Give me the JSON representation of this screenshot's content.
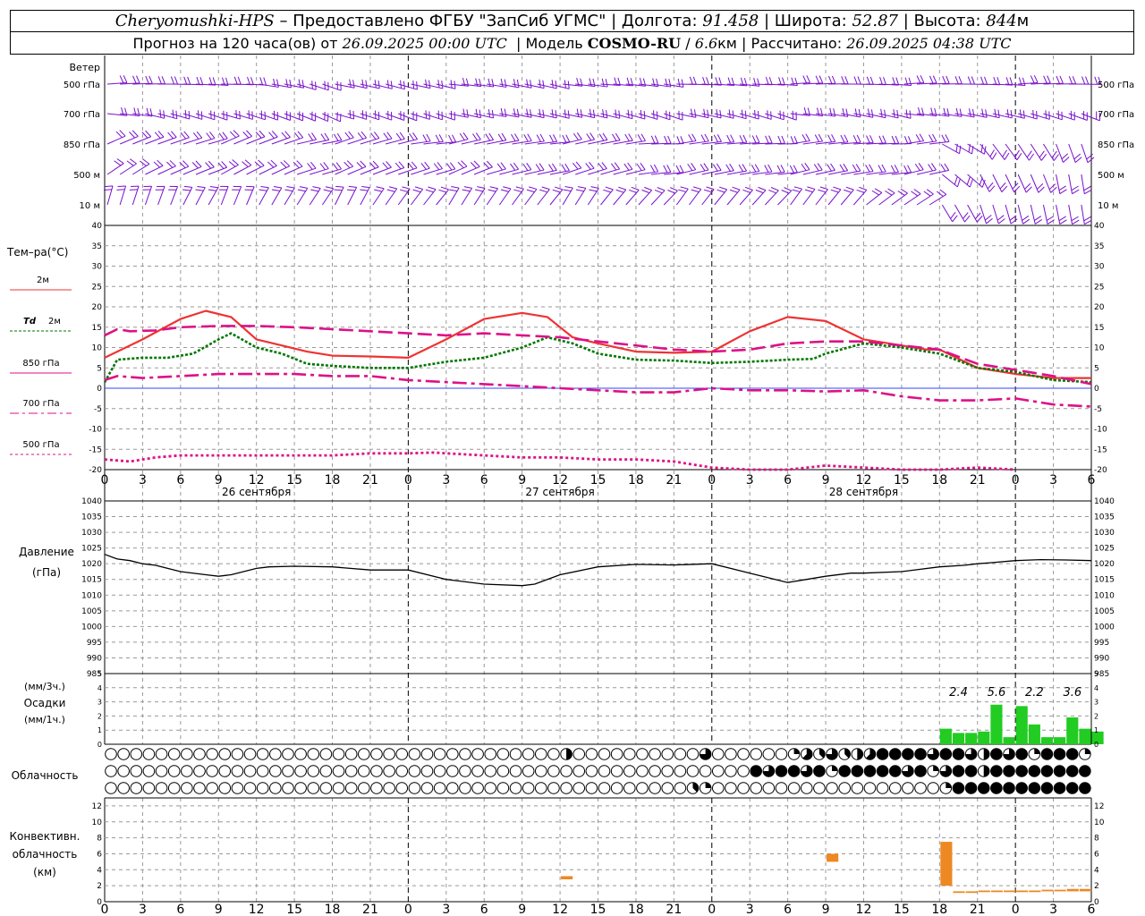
{
  "header": {
    "station": "Cheryomushki-HPS",
    "provided_by": "– Предоставлено ФГБУ \"ЗапСиб УГМС\"",
    "lon_label": "Долгота:",
    "lon_value": "91.458",
    "lat_label": "Широта:",
    "lat_value": "52.87",
    "alt_label": "Высота:",
    "alt_value": "844",
    "alt_unit": "м",
    "forecast_label": "Прогноз на 120 часа(ов) от",
    "forecast_start": "26.09.2025 00:00 UTC",
    "model_label": "Модель",
    "model_name": "COSMO-RU",
    "model_res": "6.6",
    "model_res_unit": "км",
    "computed_label": "Рассчитано:",
    "computed_time": "26.09.2025 04:38 UTC"
  },
  "labels": {
    "wind": "Ветер",
    "wind_levels": [
      "500 гПа",
      "700 гПа",
      "850 гПа",
      "500 м",
      "10 м"
    ],
    "temp_title": "Тем–ра(°С)",
    "t2m": "2м",
    "td": "Td",
    "td2m": "2м",
    "t850": "850 гПа",
    "t700": "700 гПа",
    "t500": "500 гПа",
    "pressure_title": "Давление",
    "pressure_unit": "(гПа)",
    "precip_unit_top": "(мм/3ч.)",
    "precip_title": "Осадки",
    "precip_unit_bottom": "(мм/1ч.)",
    "cloud_title": "Облачность",
    "conv_title1": "Конвективн.",
    "conv_title2": "облачность",
    "conv_unit": "(км)",
    "dates": [
      "26 сентября",
      "27 сентября",
      "28 сентября"
    ]
  },
  "chart_data": {
    "type": "meteogram",
    "hours_total": 78,
    "hour_ticks": [
      "0",
      "3",
      "6",
      "9",
      "12",
      "15",
      "18",
      "21",
      "0",
      "3",
      "6",
      "9",
      "12",
      "15",
      "18",
      "21",
      "0",
      "3",
      "6",
      "9",
      "12",
      "15",
      "18",
      "21",
      "0",
      "3",
      "6"
    ],
    "colors": {
      "t2m": "#ee3333",
      "td2m": "#007700",
      "t850": "#dd1188",
      "t700": "#dd1188",
      "t500": "#dd1188",
      "wind": "#7711cc",
      "pressure": "#000000",
      "precip": "#22cc22",
      "conv": "#ee8822"
    },
    "temperature": {
      "ylim": [
        -20,
        40
      ],
      "yticks": [
        -20,
        -15,
        -10,
        -5,
        0,
        5,
        10,
        15,
        20,
        25,
        30,
        35,
        40
      ],
      "series": [
        {
          "key": "t2m",
          "x": [
            0,
            3,
            6,
            8,
            10,
            12,
            14,
            16,
            18,
            21,
            24,
            27,
            30,
            33,
            35,
            37,
            39,
            42,
            45,
            48,
            51,
            54,
            57,
            60,
            63,
            65,
            66,
            69,
            72,
            75,
            78
          ],
          "values": [
            7.5,
            12,
            17,
            19,
            17.5,
            12,
            10.5,
            9,
            8,
            7.8,
            7.5,
            12,
            17,
            18.5,
            17.5,
            12.5,
            11,
            9,
            8.7,
            9,
            14,
            17.5,
            16.5,
            12,
            10.5,
            9.5,
            9.5,
            5,
            3.5,
            2.5,
            2.5
          ]
        },
        {
          "key": "td2m",
          "x": [
            0,
            1,
            3,
            5,
            7,
            9,
            10,
            12,
            14,
            16,
            18,
            21,
            24,
            27,
            30,
            33,
            35,
            37,
            39,
            42,
            45,
            48,
            51,
            54,
            56,
            57,
            60,
            63,
            65,
            66,
            69,
            72,
            75,
            78
          ],
          "values": [
            1.5,
            7,
            7.5,
            7.5,
            8.5,
            12,
            13.5,
            10,
            8.5,
            6,
            5.5,
            5,
            5,
            6.5,
            7.5,
            10,
            12.5,
            11,
            8.5,
            7,
            6.8,
            6.2,
            6.5,
            7,
            7.2,
            8.5,
            11,
            10,
            9,
            8.5,
            5,
            4,
            2,
            1.5
          ]
        },
        {
          "key": "t850",
          "x": [
            0,
            1,
            2,
            4,
            6,
            9,
            12,
            15,
            18,
            21,
            24,
            27,
            30,
            33,
            36,
            39,
            42,
            45,
            48,
            51,
            54,
            57,
            60,
            63,
            66,
            69,
            72,
            75,
            78
          ],
          "values": [
            13,
            14.5,
            14,
            14.2,
            15,
            15.3,
            15.3,
            15,
            14.5,
            14,
            13.5,
            13,
            13.5,
            13,
            12.5,
            11.5,
            10.5,
            9.5,
            9,
            9.5,
            11,
            11.5,
            11.5,
            10.5,
            9.5,
            6,
            4.5,
            3,
            1
          ]
        },
        {
          "key": "t700",
          "x": [
            0,
            1,
            3,
            6,
            9,
            12,
            15,
            18,
            21,
            24,
            27,
            30,
            33,
            36,
            39,
            42,
            45,
            48,
            51,
            54,
            57,
            60,
            63,
            66,
            69,
            72,
            75,
            78
          ],
          "values": [
            2,
            3,
            2.5,
            3,
            3.5,
            3.5,
            3.5,
            3,
            3,
            2,
            1.5,
            1,
            0.5,
            0,
            -0.5,
            -1,
            -1,
            0,
            -0.5,
            -0.5,
            -0.8,
            -0.5,
            -2,
            -3,
            -3,
            -2.5,
            -4,
            -4.5
          ]
        },
        {
          "key": "t500",
          "x": [
            0,
            2,
            4,
            6,
            9,
            12,
            15,
            18,
            21,
            24,
            26,
            27,
            30,
            33,
            36,
            39,
            42,
            45,
            48,
            51,
            54,
            57,
            60,
            63,
            66,
            69,
            72
          ],
          "values": [
            -17.5,
            -18,
            -17,
            -16.5,
            -16.5,
            -16.5,
            -16.5,
            -16.5,
            -16,
            -16,
            -15.8,
            -16,
            -16.5,
            -17,
            -17,
            -17.5,
            -17.5,
            -18,
            -19.5,
            -20,
            -20,
            -19,
            -19.5,
            -20,
            -20,
            -19.5,
            -20
          ]
        }
      ]
    },
    "pressure": {
      "ylim": [
        985,
        1040
      ],
      "yticks": [
        985,
        990,
        995,
        1000,
        1005,
        1010,
        1015,
        1020,
        1025,
        1030,
        1035,
        1040
      ],
      "x": [
        0,
        1,
        2,
        3,
        4,
        6,
        8,
        9,
        10,
        12,
        13,
        15,
        18,
        21,
        24,
        27,
        30,
        33,
        34,
        36,
        39,
        42,
        45,
        48,
        51,
        54,
        57,
        59,
        60,
        63,
        66,
        68,
        69,
        70,
        72,
        74,
        76,
        78
      ],
      "values": [
        1023,
        1021.5,
        1021,
        1020,
        1019.5,
        1017.5,
        1016.5,
        1016,
        1016.5,
        1018.5,
        1019,
        1019.2,
        1019,
        1018,
        1018,
        1015,
        1013.5,
        1013,
        1013.5,
        1016.5,
        1019,
        1019.8,
        1019.6,
        1020,
        1017,
        1014,
        1016,
        1017,
        1017,
        1017.5,
        1019,
        1019.5,
        1020,
        1020.3,
        1021,
        1021.3,
        1021.2,
        1021
      ]
    },
    "precipitation": {
      "ylim": [
        0,
        5
      ],
      "yticks": [
        0,
        1,
        2,
        3,
        4,
        5
      ],
      "hourly": [
        1.1,
        0.8,
        0.8,
        0.9,
        2.8,
        0.5,
        2.7,
        1.4,
        0.5,
        0.5,
        1.9,
        1.1,
        0.9
      ],
      "hourly_start": 66,
      "totals": [
        "2.4",
        "5.6",
        "2.2",
        "3.6"
      ],
      "totals_at": [
        67.5,
        70.5,
        73.5,
        76.5
      ]
    },
    "cloud_cover": {
      "note": "levels high, middle, low; values in eighths for 78 hourly slots",
      "high_events": {
        "36": 4,
        "47": 6,
        "54": 2,
        "55": 5,
        "56": 3,
        "57": 6,
        "58": 3,
        "59": 4,
        "60": 5,
        "61": 8,
        "62": 8,
        "63": 8,
        "64": 8,
        "65": 6,
        "66": 8,
        "67": 8,
        "68": 6,
        "69": 4,
        "70": 8,
        "71": 6,
        "72": 8,
        "73": 2,
        "74": 8,
        "75": 8,
        "76": 8,
        "77": 2
      },
      "mid_events": {
        "51": 8,
        "52": 6,
        "53": 8,
        "54": 8,
        "55": 6,
        "56": 8,
        "57": 2,
        "58": 8,
        "59": 8,
        "60": 8,
        "61": 8,
        "62": 8,
        "63": 6,
        "64": 8,
        "65": 2,
        "66": 6,
        "67": 8,
        "68": 8,
        "69": 4,
        "70": 8,
        "71": 8,
        "72": 8,
        "73": 8,
        "74": 8,
        "75": 8,
        "76": 8,
        "77": 8
      },
      "low_events": {
        "46": 3,
        "47": 2,
        "66": 2,
        "67": 8,
        "68": 8,
        "69": 8,
        "70": 8,
        "71": 8,
        "72": 8,
        "73": 8,
        "74": 8,
        "75": 8,
        "76": 8,
        "77": 8
      }
    },
    "convective": {
      "ylim": [
        0,
        13
      ],
      "yticks": [
        0,
        2,
        4,
        6,
        8,
        10,
        12
      ],
      "bars": [
        {
          "h": 36,
          "base": 2.8,
          "top": 3.2
        },
        {
          "h": 57,
          "base": 5,
          "top": 6
        },
        {
          "h": 66,
          "base": 2,
          "top": 7.5
        },
        {
          "h": 67,
          "base": 1.1,
          "top": 1.3
        },
        {
          "h": 68,
          "base": 1.1,
          "top": 1.3
        },
        {
          "h": 69,
          "base": 1.2,
          "top": 1.4
        },
        {
          "h": 70,
          "base": 1.2,
          "top": 1.4
        },
        {
          "h": 71,
          "base": 1.2,
          "top": 1.4
        },
        {
          "h": 72,
          "base": 1.2,
          "top": 1.4
        },
        {
          "h": 73,
          "base": 1.2,
          "top": 1.4
        },
        {
          "h": 74,
          "base": 1.3,
          "top": 1.5
        },
        {
          "h": 75,
          "base": 1.3,
          "top": 1.5
        },
        {
          "h": 76,
          "base": 1.3,
          "top": 1.6
        },
        {
          "h": 77,
          "base": 1.3,
          "top": 1.6
        }
      ]
    },
    "wind_rows": [
      {
        "level": "500 гПа",
        "dir": [
          270,
          270,
          270,
          275,
          280,
          285,
          285,
          285,
          280,
          280,
          280,
          280,
          280,
          275,
          275,
          275,
          275,
          270,
          270,
          270,
          270,
          270,
          270,
          270,
          270,
          270
        ]
      },
      {
        "level": "700 гПа",
        "dir": [
          280,
          285,
          285,
          290,
          290,
          290,
          290,
          290,
          285,
          285,
          280,
          280,
          285,
          285,
          285,
          285,
          285,
          285,
          280,
          280,
          280,
          280,
          280,
          280,
          290,
          290
        ]
      },
      {
        "level": "850 гПа",
        "dir": [
          250,
          250,
          250,
          250,
          250,
          255,
          255,
          255,
          260,
          260,
          260,
          260,
          260,
          260,
          265,
          265,
          265,
          265,
          265,
          265,
          265,
          265,
          300,
          320,
          330,
          340
        ]
      },
      {
        "level": "500 м",
        "dir": [
          240,
          245,
          245,
          245,
          245,
          250,
          250,
          250,
          250,
          250,
          255,
          255,
          255,
          255,
          260,
          260,
          260,
          260,
          260,
          260,
          260,
          260,
          310,
          330,
          340,
          350
        ]
      },
      {
        "level": "10 м",
        "dir": [
          200,
          200,
          205,
          205,
          210,
          210,
          210,
          215,
          215,
          215,
          215,
          215,
          215,
          220,
          220,
          220,
          220,
          220,
          220,
          220,
          230,
          240,
          330,
          340,
          350,
          350
        ]
      }
    ]
  }
}
